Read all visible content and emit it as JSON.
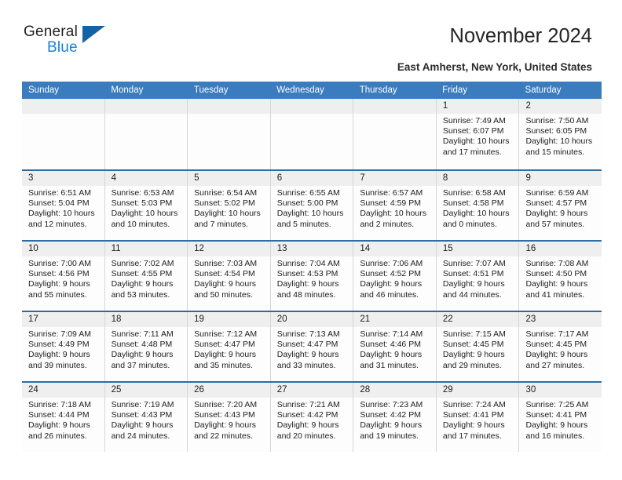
{
  "brand": {
    "name_top": "General",
    "name_bottom": "Blue",
    "triangle_color": "#1464a5",
    "blue_color": "#1b82d2"
  },
  "header": {
    "title": "November 2024",
    "location": "East Amherst, New York, United States"
  },
  "theme": {
    "header_blue": "#3a7cbe",
    "row_divider": "#2d6da4",
    "date_band": "#efefef",
    "cell_bg": "#fdfdfd"
  },
  "weekdays": [
    "Sunday",
    "Monday",
    "Tuesday",
    "Wednesday",
    "Thursday",
    "Friday",
    "Saturday"
  ],
  "weeks": [
    [
      {
        "day": ""
      },
      {
        "day": ""
      },
      {
        "day": ""
      },
      {
        "day": ""
      },
      {
        "day": ""
      },
      {
        "day": "1",
        "sunrise": "Sunrise: 7:49 AM",
        "sunset": "Sunset: 6:07 PM",
        "daylight": "Daylight: 10 hours and 17 minutes."
      },
      {
        "day": "2",
        "sunrise": "Sunrise: 7:50 AM",
        "sunset": "Sunset: 6:05 PM",
        "daylight": "Daylight: 10 hours and 15 minutes."
      }
    ],
    [
      {
        "day": "3",
        "sunrise": "Sunrise: 6:51 AM",
        "sunset": "Sunset: 5:04 PM",
        "daylight": "Daylight: 10 hours and 12 minutes."
      },
      {
        "day": "4",
        "sunrise": "Sunrise: 6:53 AM",
        "sunset": "Sunset: 5:03 PM",
        "daylight": "Daylight: 10 hours and 10 minutes."
      },
      {
        "day": "5",
        "sunrise": "Sunrise: 6:54 AM",
        "sunset": "Sunset: 5:02 PM",
        "daylight": "Daylight: 10 hours and 7 minutes."
      },
      {
        "day": "6",
        "sunrise": "Sunrise: 6:55 AM",
        "sunset": "Sunset: 5:00 PM",
        "daylight": "Daylight: 10 hours and 5 minutes."
      },
      {
        "day": "7",
        "sunrise": "Sunrise: 6:57 AM",
        "sunset": "Sunset: 4:59 PM",
        "daylight": "Daylight: 10 hours and 2 minutes."
      },
      {
        "day": "8",
        "sunrise": "Sunrise: 6:58 AM",
        "sunset": "Sunset: 4:58 PM",
        "daylight": "Daylight: 10 hours and 0 minutes."
      },
      {
        "day": "9",
        "sunrise": "Sunrise: 6:59 AM",
        "sunset": "Sunset: 4:57 PM",
        "daylight": "Daylight: 9 hours and 57 minutes."
      }
    ],
    [
      {
        "day": "10",
        "sunrise": "Sunrise: 7:00 AM",
        "sunset": "Sunset: 4:56 PM",
        "daylight": "Daylight: 9 hours and 55 minutes."
      },
      {
        "day": "11",
        "sunrise": "Sunrise: 7:02 AM",
        "sunset": "Sunset: 4:55 PM",
        "daylight": "Daylight: 9 hours and 53 minutes."
      },
      {
        "day": "12",
        "sunrise": "Sunrise: 7:03 AM",
        "sunset": "Sunset: 4:54 PM",
        "daylight": "Daylight: 9 hours and 50 minutes."
      },
      {
        "day": "13",
        "sunrise": "Sunrise: 7:04 AM",
        "sunset": "Sunset: 4:53 PM",
        "daylight": "Daylight: 9 hours and 48 minutes."
      },
      {
        "day": "14",
        "sunrise": "Sunrise: 7:06 AM",
        "sunset": "Sunset: 4:52 PM",
        "daylight": "Daylight: 9 hours and 46 minutes."
      },
      {
        "day": "15",
        "sunrise": "Sunrise: 7:07 AM",
        "sunset": "Sunset: 4:51 PM",
        "daylight": "Daylight: 9 hours and 44 minutes."
      },
      {
        "day": "16",
        "sunrise": "Sunrise: 7:08 AM",
        "sunset": "Sunset: 4:50 PM",
        "daylight": "Daylight: 9 hours and 41 minutes."
      }
    ],
    [
      {
        "day": "17",
        "sunrise": "Sunrise: 7:09 AM",
        "sunset": "Sunset: 4:49 PM",
        "daylight": "Daylight: 9 hours and 39 minutes."
      },
      {
        "day": "18",
        "sunrise": "Sunrise: 7:11 AM",
        "sunset": "Sunset: 4:48 PM",
        "daylight": "Daylight: 9 hours and 37 minutes."
      },
      {
        "day": "19",
        "sunrise": "Sunrise: 7:12 AM",
        "sunset": "Sunset: 4:47 PM",
        "daylight": "Daylight: 9 hours and 35 minutes."
      },
      {
        "day": "20",
        "sunrise": "Sunrise: 7:13 AM",
        "sunset": "Sunset: 4:47 PM",
        "daylight": "Daylight: 9 hours and 33 minutes."
      },
      {
        "day": "21",
        "sunrise": "Sunrise: 7:14 AM",
        "sunset": "Sunset: 4:46 PM",
        "daylight": "Daylight: 9 hours and 31 minutes."
      },
      {
        "day": "22",
        "sunrise": "Sunrise: 7:15 AM",
        "sunset": "Sunset: 4:45 PM",
        "daylight": "Daylight: 9 hours and 29 minutes."
      },
      {
        "day": "23",
        "sunrise": "Sunrise: 7:17 AM",
        "sunset": "Sunset: 4:45 PM",
        "daylight": "Daylight: 9 hours and 27 minutes."
      }
    ],
    [
      {
        "day": "24",
        "sunrise": "Sunrise: 7:18 AM",
        "sunset": "Sunset: 4:44 PM",
        "daylight": "Daylight: 9 hours and 26 minutes."
      },
      {
        "day": "25",
        "sunrise": "Sunrise: 7:19 AM",
        "sunset": "Sunset: 4:43 PM",
        "daylight": "Daylight: 9 hours and 24 minutes."
      },
      {
        "day": "26",
        "sunrise": "Sunrise: 7:20 AM",
        "sunset": "Sunset: 4:43 PM",
        "daylight": "Daylight: 9 hours and 22 minutes."
      },
      {
        "day": "27",
        "sunrise": "Sunrise: 7:21 AM",
        "sunset": "Sunset: 4:42 PM",
        "daylight": "Daylight: 9 hours and 20 minutes."
      },
      {
        "day": "28",
        "sunrise": "Sunrise: 7:23 AM",
        "sunset": "Sunset: 4:42 PM",
        "daylight": "Daylight: 9 hours and 19 minutes."
      },
      {
        "day": "29",
        "sunrise": "Sunrise: 7:24 AM",
        "sunset": "Sunset: 4:41 PM",
        "daylight": "Daylight: 9 hours and 17 minutes."
      },
      {
        "day": "30",
        "sunrise": "Sunrise: 7:25 AM",
        "sunset": "Sunset: 4:41 PM",
        "daylight": "Daylight: 9 hours and 16 minutes."
      }
    ]
  ]
}
